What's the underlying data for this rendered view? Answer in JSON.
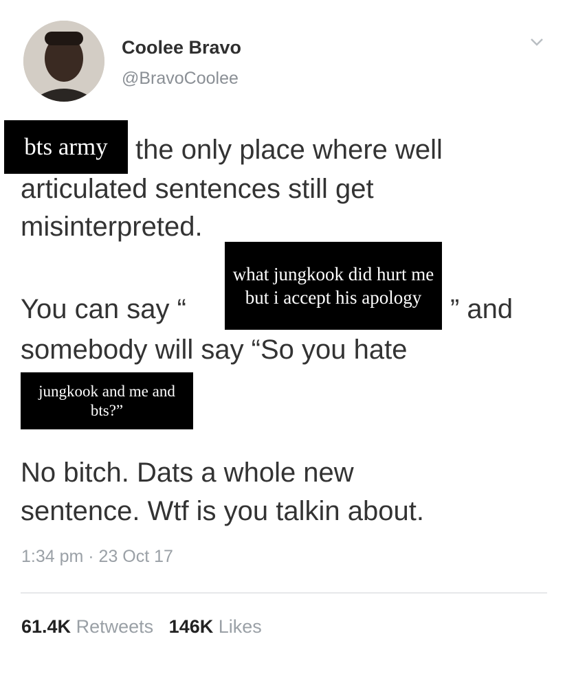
{
  "tweet": {
    "display_name": "Coolee Bravo",
    "handle": "@BravoCoolee",
    "line1": "the only place where well",
    "line2": "articulated sentences still get",
    "line3": "misinterpreted.",
    "line4_start": "You can say “",
    "line4_end": "” and",
    "line5": "somebody will say “So you hate",
    "line6": "No bitch. Dats a whole new",
    "line7": "sentence. Wtf is you talkin about.",
    "timestamp": "1:34 pm · 23 Oct 17",
    "retweets_count": "61.4K",
    "retweets_label": "Retweets",
    "likes_count": "146K",
    "likes_label": "Likes"
  },
  "overlays": {
    "top_left": "bts army",
    "middle": "what jungkook did hurt me but i accept his apology",
    "bottom": "jungkook and me and bts?”"
  },
  "icons": {
    "menu": "chevron-down-icon",
    "avatar": "profile-photo"
  }
}
